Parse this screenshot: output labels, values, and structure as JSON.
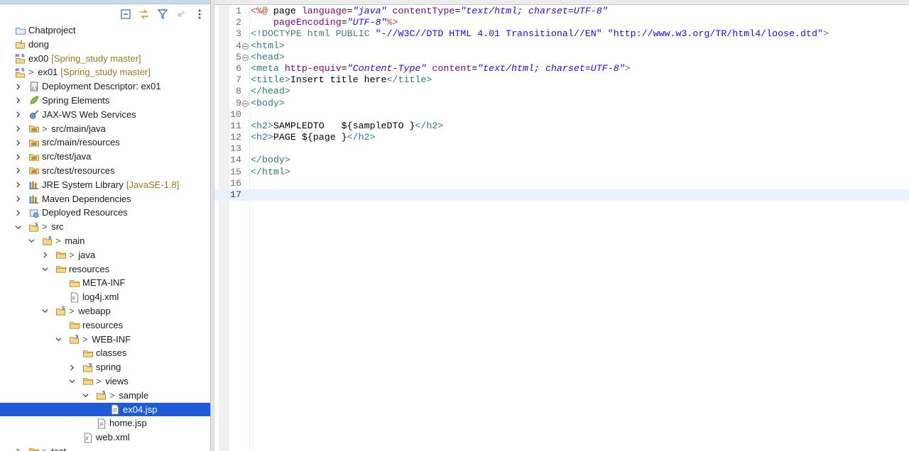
{
  "explorer": {
    "toolbar": [
      {
        "name": "collapse-all-icon"
      },
      {
        "name": "link-with-editor-icon"
      },
      {
        "name": "filter-icon"
      },
      {
        "name": "focus-active-task-icon"
      },
      {
        "name": "view-menu-icon"
      }
    ],
    "tree": [
      {
        "indent": 0,
        "chevron": "none",
        "icon": "project-folder",
        "prefix": "",
        "label": "Chatproject",
        "decor": ""
      },
      {
        "indent": 0,
        "chevron": "none",
        "icon": "project-java",
        "prefix": "",
        "label": "dong",
        "decor": ""
      },
      {
        "indent": 0,
        "chevron": "none",
        "icon": "project-maven",
        "prefix": "",
        "label": "ex00",
        "decor": "[Spring_study master]"
      },
      {
        "indent": 0,
        "chevron": "none",
        "icon": "project-maven",
        "prefix": "> ",
        "label": "ex01",
        "decor": "[Spring_study master]"
      },
      {
        "indent": 1,
        "chevron": "right",
        "icon": "deployment-descriptor",
        "prefix": "",
        "label": "Deployment Descriptor: ex01",
        "decor": ""
      },
      {
        "indent": 1,
        "chevron": "right",
        "icon": "spring-leaf",
        "prefix": "",
        "label": "Spring Elements",
        "decor": ""
      },
      {
        "indent": 1,
        "chevron": "right",
        "icon": "web-services",
        "prefix": "",
        "label": "JAX-WS Web Services",
        "decor": ""
      },
      {
        "indent": 1,
        "chevron": "right",
        "icon": "source-folder",
        "prefix": "> ",
        "label": "src/main/java",
        "decor": ""
      },
      {
        "indent": 1,
        "chevron": "right",
        "icon": "source-folder",
        "prefix": "",
        "label": "src/main/resources",
        "decor": ""
      },
      {
        "indent": 1,
        "chevron": "right",
        "icon": "source-folder",
        "prefix": "",
        "label": "src/test/java",
        "decor": ""
      },
      {
        "indent": 1,
        "chevron": "right",
        "icon": "source-folder",
        "prefix": "",
        "label": "src/test/resources",
        "decor": ""
      },
      {
        "indent": 1,
        "chevron": "right",
        "icon": "library",
        "prefix": "",
        "label": "JRE System Library",
        "decor": "[JavaSE-1.8]"
      },
      {
        "indent": 1,
        "chevron": "right",
        "icon": "library",
        "prefix": "",
        "label": "Maven Dependencies",
        "decor": ""
      },
      {
        "indent": 1,
        "chevron": "right",
        "icon": "deployed-resources",
        "prefix": "",
        "label": "Deployed Resources",
        "decor": ""
      },
      {
        "indent": 1,
        "chevron": "down",
        "icon": "folder-git",
        "prefix": "> ",
        "label": "src",
        "decor": ""
      },
      {
        "indent": 2,
        "chevron": "down",
        "icon": "folder-git",
        "prefix": "> ",
        "label": "main",
        "decor": ""
      },
      {
        "indent": 3,
        "chevron": "right",
        "icon": "folder-open",
        "prefix": "> ",
        "label": "java",
        "decor": ""
      },
      {
        "indent": 3,
        "chevron": "down",
        "icon": "folder-open",
        "prefix": "",
        "label": "resources",
        "decor": ""
      },
      {
        "indent": 4,
        "chevron": "none",
        "icon": "folder-open",
        "prefix": "",
        "label": "META-INF",
        "decor": ""
      },
      {
        "indent": 4,
        "chevron": "none",
        "icon": "xml-file",
        "prefix": "",
        "label": "log4j.xml",
        "decor": ""
      },
      {
        "indent": 3,
        "chevron": "down",
        "icon": "folder-git",
        "prefix": "> ",
        "label": "webapp",
        "decor": ""
      },
      {
        "indent": 4,
        "chevron": "none",
        "icon": "folder-open",
        "prefix": "",
        "label": "resources",
        "decor": ""
      },
      {
        "indent": 4,
        "chevron": "down",
        "icon": "folder-git",
        "prefix": "> ",
        "label": "WEB-INF",
        "decor": ""
      },
      {
        "indent": 5,
        "chevron": "none",
        "icon": "folder-open",
        "prefix": "",
        "label": "classes",
        "decor": ""
      },
      {
        "indent": 5,
        "chevron": "right",
        "icon": "folder-git",
        "prefix": "",
        "label": "spring",
        "decor": ""
      },
      {
        "indent": 5,
        "chevron": "down",
        "icon": "folder-open",
        "prefix": "> ",
        "label": "views",
        "decor": ""
      },
      {
        "indent": 6,
        "chevron": "down",
        "icon": "folder-git",
        "prefix": "> ",
        "label": "sample",
        "decor": ""
      },
      {
        "indent": 7,
        "chevron": "none",
        "icon": "jsp-file",
        "prefix": "",
        "label": "ex04.jsp",
        "decor": "",
        "selected": true
      },
      {
        "indent": 6,
        "chevron": "none",
        "icon": "jsp-file",
        "prefix": "",
        "label": "home.jsp",
        "decor": ""
      },
      {
        "indent": 5,
        "chevron": "none",
        "icon": "xml-file",
        "prefix": "",
        "label": "web.xml",
        "decor": ""
      },
      {
        "indent": 1,
        "chevron": "right",
        "icon": "folder-open",
        "prefix": "> ",
        "label": "test",
        "decor": ""
      }
    ]
  },
  "editor": {
    "current_line": 17,
    "lines": [
      {
        "n": "1",
        "fold": false,
        "parts": [
          [
            "dir",
            "<%@ "
          ],
          [
            "txt",
            "page "
          ],
          [
            "attr",
            "language"
          ],
          [
            "txt",
            "="
          ],
          [
            "val",
            "\"java\""
          ],
          [
            "txt",
            " "
          ],
          [
            "attr",
            "contentType"
          ],
          [
            "txt",
            "="
          ],
          [
            "val",
            "\"text/html; charset=UTF-8\""
          ]
        ]
      },
      {
        "n": "2",
        "fold": false,
        "parts": [
          [
            "txt",
            "    "
          ],
          [
            "attr",
            "pageEncoding"
          ],
          [
            "txt",
            "="
          ],
          [
            "val",
            "\"UTF-8\""
          ],
          [
            "dir",
            "%>"
          ]
        ]
      },
      {
        "n": "3",
        "fold": false,
        "parts": [
          [
            "doc",
            "<!DOCTYPE html PUBLIC "
          ],
          [
            "str",
            "\"-//W3C//DTD HTML 4.01 Transitional//EN\""
          ],
          [
            "doc",
            " "
          ],
          [
            "str",
            "\"http://www.w3.org/TR/html4/loose.dtd\""
          ],
          [
            "doc",
            ">"
          ]
        ]
      },
      {
        "n": "4",
        "fold": true,
        "parts": [
          [
            "tag",
            "<html>"
          ]
        ]
      },
      {
        "n": "5",
        "fold": true,
        "parts": [
          [
            "tag",
            "<head>"
          ]
        ]
      },
      {
        "n": "6",
        "fold": false,
        "parts": [
          [
            "tag",
            "<meta "
          ],
          [
            "attr",
            "http-equiv"
          ],
          [
            "txt",
            "="
          ],
          [
            "val",
            "\"Content-Type\""
          ],
          [
            "txt",
            " "
          ],
          [
            "attr",
            "content"
          ],
          [
            "txt",
            "="
          ],
          [
            "val",
            "\"text/html; charset=UTF-8\""
          ],
          [
            "tag",
            ">"
          ]
        ]
      },
      {
        "n": "7",
        "fold": false,
        "parts": [
          [
            "tag",
            "<title>"
          ],
          [
            "txt",
            "Insert title here"
          ],
          [
            "tag",
            "</title>"
          ]
        ]
      },
      {
        "n": "8",
        "fold": false,
        "parts": [
          [
            "tag",
            "</head>"
          ]
        ]
      },
      {
        "n": "9",
        "fold": true,
        "parts": [
          [
            "tag",
            "<body>"
          ]
        ]
      },
      {
        "n": "10",
        "fold": false,
        "parts": []
      },
      {
        "n": "11",
        "fold": false,
        "parts": [
          [
            "tag",
            "<h2>"
          ],
          [
            "txt",
            "SAMPLEDTO   ${sampleDTO }"
          ],
          [
            "tag",
            "</h2>"
          ]
        ]
      },
      {
        "n": "12",
        "fold": false,
        "parts": [
          [
            "tag",
            "<h2>"
          ],
          [
            "txt",
            "PAGE ${page }"
          ],
          [
            "tag",
            "</h2>"
          ]
        ]
      },
      {
        "n": "13",
        "fold": false,
        "parts": []
      },
      {
        "n": "14",
        "fold": false,
        "parts": [
          [
            "tag",
            "</body>"
          ]
        ]
      },
      {
        "n": "15",
        "fold": false,
        "parts": [
          [
            "tag",
            "</html>"
          ]
        ]
      },
      {
        "n": "16",
        "fold": false,
        "parts": []
      },
      {
        "n": "17",
        "fold": false,
        "parts": []
      }
    ]
  }
}
